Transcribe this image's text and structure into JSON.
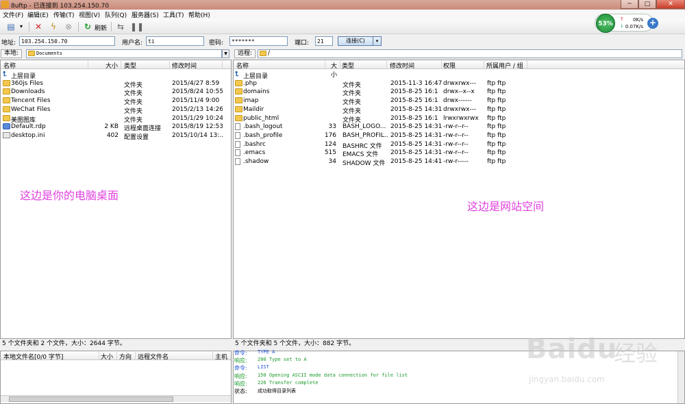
{
  "window": {
    "title": "8uftp - 已连接到 103.254.150.70",
    "minimize": "─",
    "maximize": "□",
    "close": "✕"
  },
  "menu": [
    "文件(F)",
    "编辑(E)",
    "传输(T)",
    "视图(V)",
    "队列(Q)",
    "服务器(S)",
    "工具(T)",
    "帮助(H)"
  ],
  "toolbar": {
    "refresh_label": "刷新"
  },
  "netwidget": {
    "percent": "53%",
    "up": "0K/s",
    "down": "0.07K/s",
    "plus": "+"
  },
  "connection": {
    "address_label": "地址:",
    "address_value": "103.254.150.70",
    "user_label": "用户名:",
    "user_value": "ti",
    "password_label": "密码:",
    "password_value": "*******",
    "port_label": "端口:",
    "port_value": "21",
    "connect_label": "连接(C)",
    "connect_dd": "▾"
  },
  "local": {
    "path_label": "本地:",
    "path": "Documents",
    "columns": [
      "名称",
      "大小",
      "类型",
      "修改时间"
    ],
    "rows": [
      {
        "name": "上层目录",
        "size": "",
        "type": "",
        "modified": "",
        "icon": "up-folder"
      },
      {
        "name": "360js Files",
        "size": "",
        "type": "文件夹",
        "modified": "2015/4/27 8:59",
        "icon": "folder"
      },
      {
        "name": "Downloads",
        "size": "",
        "type": "文件夹",
        "modified": "2015/8/24 10:55",
        "icon": "folder"
      },
      {
        "name": "Tencent Files",
        "size": "",
        "type": "文件夹",
        "modified": "2015/11/4 9:00",
        "icon": "folder"
      },
      {
        "name": "WeChat Files",
        "size": "",
        "type": "文件夹",
        "modified": "2015/2/13 14:26",
        "icon": "folder"
      },
      {
        "name": "美图图库",
        "size": "",
        "type": "文件夹",
        "modified": "2015/1/29 10:24",
        "icon": "folder"
      },
      {
        "name": "Default.rdp",
        "size": "2 KB",
        "type": "远程桌面连接",
        "modified": "2015/8/19 12:53",
        "icon": "rdp"
      },
      {
        "name": "desktop.ini",
        "size": "402",
        "type": "配置设置",
        "modified": "2015/10/14 13:...",
        "icon": "ini"
      }
    ],
    "status": "5 个文件夹和 2 个文件，大小：2644 字节。",
    "annotation": "这边是你的电脑桌面"
  },
  "remote": {
    "path_label": "远程:",
    "path": "/",
    "columns": [
      "名称",
      "大小",
      "类型",
      "修改时间",
      "权限",
      "所属用户 / 组"
    ],
    "rows": [
      {
        "name": "上层目录",
        "size": "",
        "type": "",
        "modified": "",
        "perm": "",
        "owner": "",
        "icon": "up-folder"
      },
      {
        "name": ".php",
        "size": "",
        "type": "文件夹",
        "modified": "2015-11-3 16:47",
        "perm": "drwxrwx---",
        "owner": "ftp ftp",
        "icon": "folder"
      },
      {
        "name": "domains",
        "size": "",
        "type": "文件夹",
        "modified": "2015-8-25 16:1",
        "perm": "drwx--x--x",
        "owner": "ftp ftp",
        "icon": "folder"
      },
      {
        "name": "imap",
        "size": "",
        "type": "文件夹",
        "modified": "2015-8-25 16:1",
        "perm": "drwx------",
        "owner": "ftp ftp",
        "icon": "folder"
      },
      {
        "name": "Maildir",
        "size": "",
        "type": "文件夹",
        "modified": "2015-8-25 14:31",
        "perm": "drwxrwx---",
        "owner": "ftp ftp",
        "icon": "folder"
      },
      {
        "name": "public_html",
        "size": "",
        "type": "文件夹",
        "modified": "2015-8-25 16:1",
        "perm": "lrwxrwxrwx",
        "owner": "ftp ftp",
        "icon": "folder"
      },
      {
        "name": ".bash_logout",
        "size": "33",
        "type": "BASH_LOGO...",
        "modified": "2015-8-25 14:31",
        "perm": "-rw-r--r--",
        "owner": "ftp ftp",
        "icon": "file"
      },
      {
        "name": ".bash_profile",
        "size": "176",
        "type": "BASH_PROFIL...",
        "modified": "2015-8-25 14:31",
        "perm": "-rw-r--r--",
        "owner": "ftp ftp",
        "icon": "file"
      },
      {
        "name": ".bashrc",
        "size": "124",
        "type": "BASHRC 文件",
        "modified": "2015-8-25 14:31",
        "perm": "-rw-r--r--",
        "owner": "ftp ftp",
        "icon": "file"
      },
      {
        "name": ".emacs",
        "size": "515",
        "type": "EMACS 文件",
        "modified": "2015-8-25 14:31",
        "perm": "-rw-r--r--",
        "owner": "ftp ftp",
        "icon": "file"
      },
      {
        "name": ".shadow",
        "size": "34",
        "type": "SHADOW 文件",
        "modified": "2015-8-25 14:41",
        "perm": "-rw-r-----",
        "owner": "ftp ftp",
        "icon": "file"
      }
    ],
    "status": "5 个文件夹和 5 个文件，大小：882 字节。",
    "annotation": "这边是网站空间"
  },
  "queue": {
    "columns": [
      "本地文件名[0/0 字节]",
      "大小",
      "方向",
      "远程文件名",
      "主机"
    ]
  },
  "log": [
    {
      "key": "命令:",
      "value": "TYPE A",
      "color": "#1a4fd8"
    },
    {
      "key": "响应:",
      "value": "200 Type set to A",
      "color": "#1a9a2a"
    },
    {
      "key": "命令:",
      "value": "LIST",
      "color": "#1a4fd8"
    },
    {
      "key": "响应:",
      "value": "150 Opening ASCII mode data connection for file list",
      "color": "#1a9a2a"
    },
    {
      "key": "响应:",
      "value": "226 Transfer complete",
      "color": "#1a9a2a"
    },
    {
      "key": "状态:",
      "value": "成功取得目录列表",
      "color": "#000000"
    }
  ],
  "watermark": {
    "brand": "Baidu",
    "brand_suffix": "经验",
    "url": "jingyan.baidu.com"
  }
}
